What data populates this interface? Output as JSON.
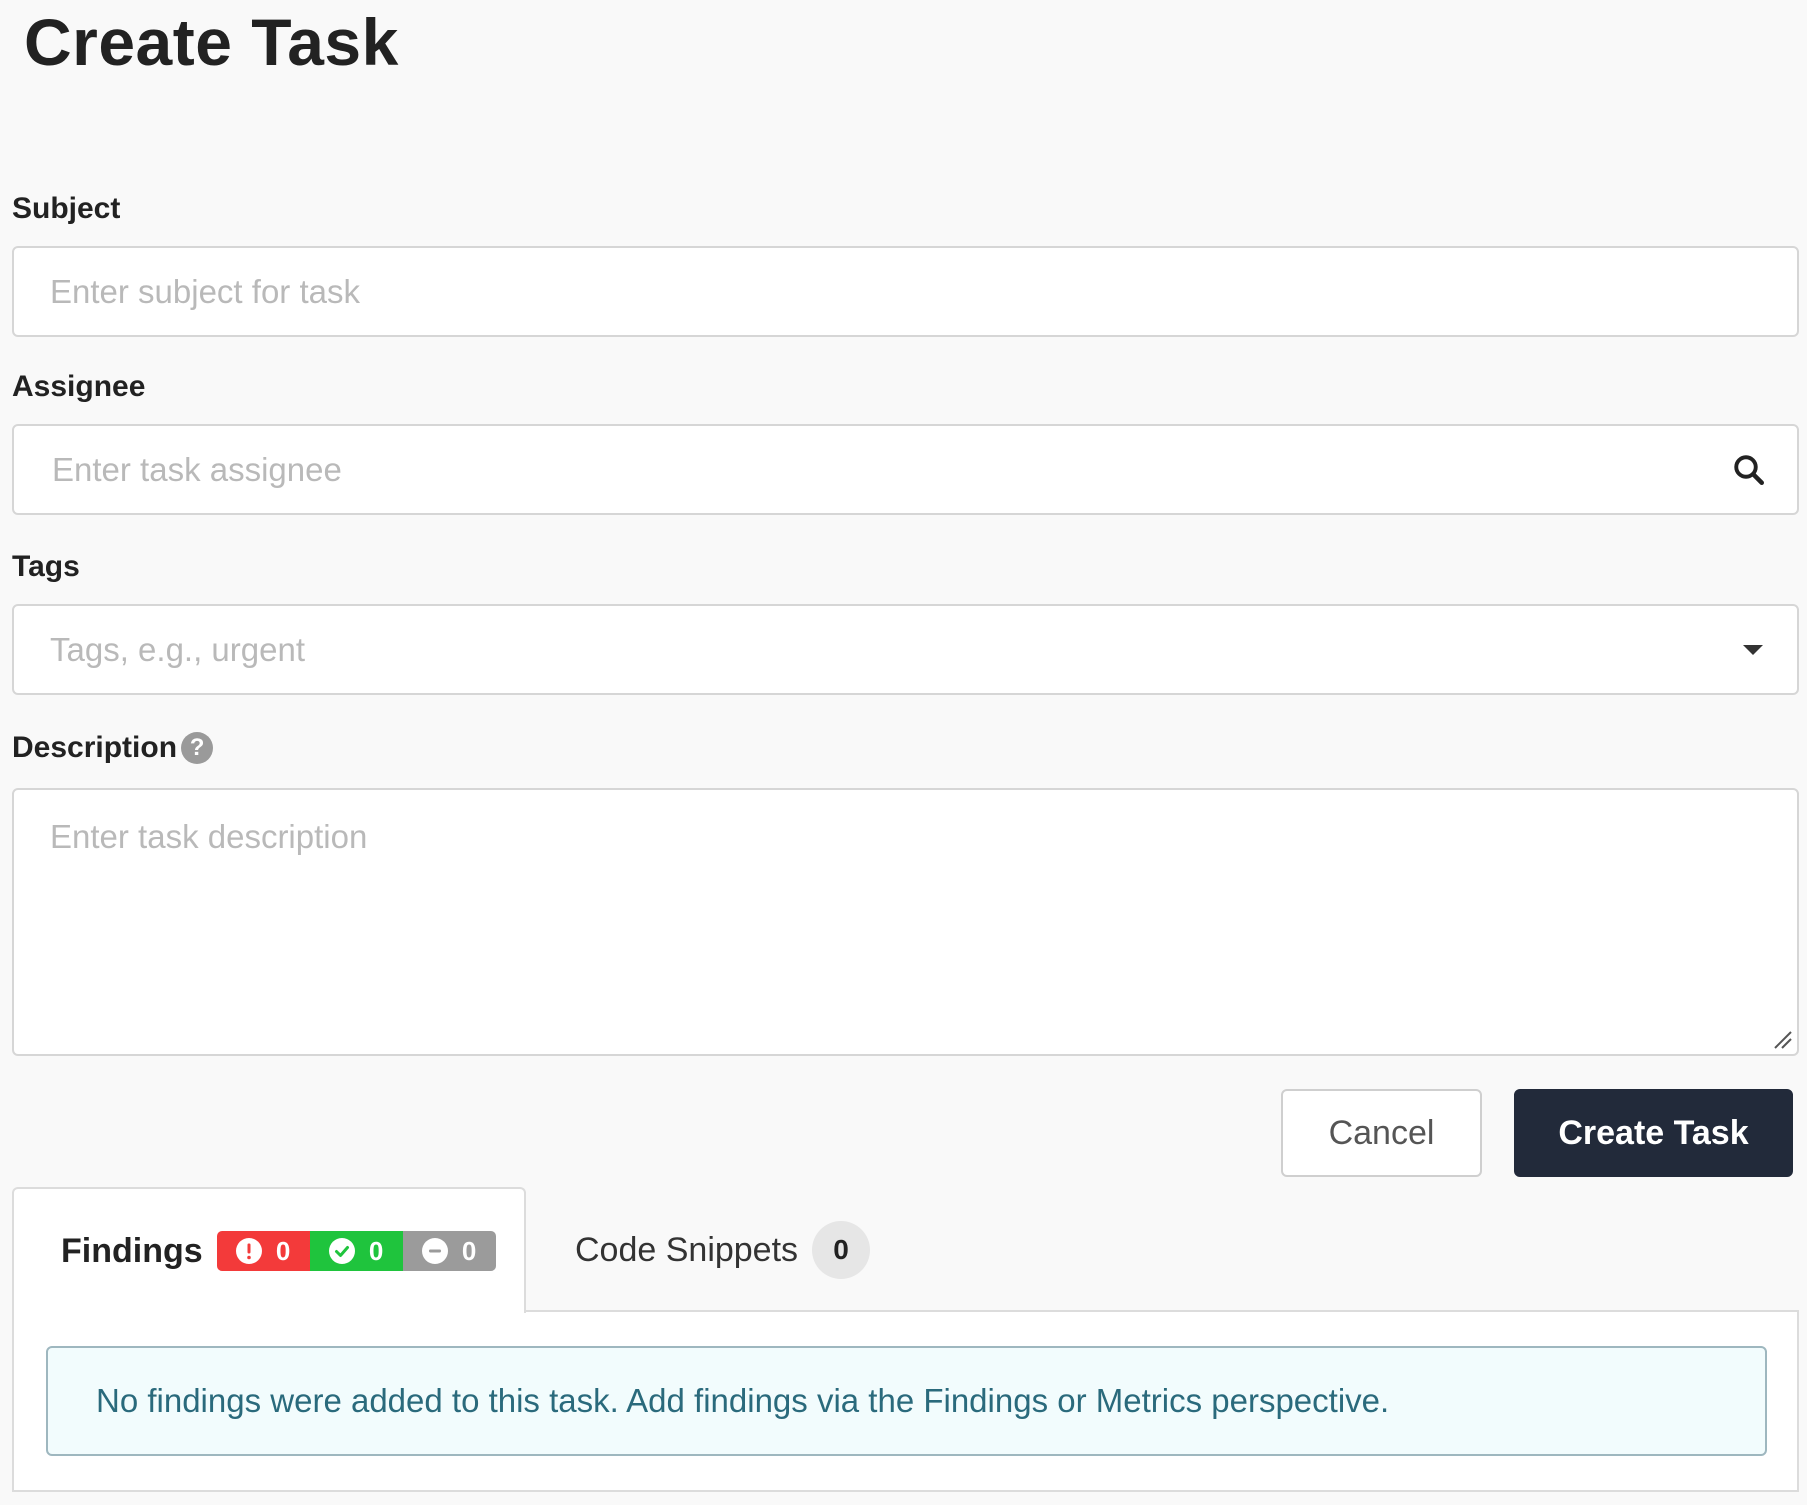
{
  "page": {
    "title": "Create Task"
  },
  "form": {
    "subject": {
      "label": "Subject",
      "placeholder": "Enter subject for task",
      "value": ""
    },
    "assignee": {
      "label": "Assignee",
      "placeholder": "Enter task assignee",
      "value": "",
      "icon": "search-icon"
    },
    "tags": {
      "label": "Tags",
      "placeholder": "Tags, e.g., urgent",
      "value": "",
      "icon": "caret-down-icon"
    },
    "description": {
      "label": "Description",
      "help_icon_glyph": "?",
      "placeholder": "Enter task description",
      "value": ""
    }
  },
  "actions": {
    "cancel_label": "Cancel",
    "create_label": "Create Task"
  },
  "tabs": {
    "findings": {
      "label": "Findings",
      "counts": {
        "error": "0",
        "success": "0",
        "neutral": "0"
      },
      "active": true
    },
    "code_snippets": {
      "label": "Code Snippets",
      "count": "0",
      "active": false
    }
  },
  "alert": {
    "message": "No findings were added to this task. Add findings via the Findings or Metrics perspective."
  },
  "colors": {
    "primary_button": "#222a3a",
    "error": "#f33a3a",
    "success": "#1fc43d",
    "neutral": "#9b9b9b",
    "alert_text": "#2a6a7c",
    "alert_bg": "#f2fcfd"
  }
}
